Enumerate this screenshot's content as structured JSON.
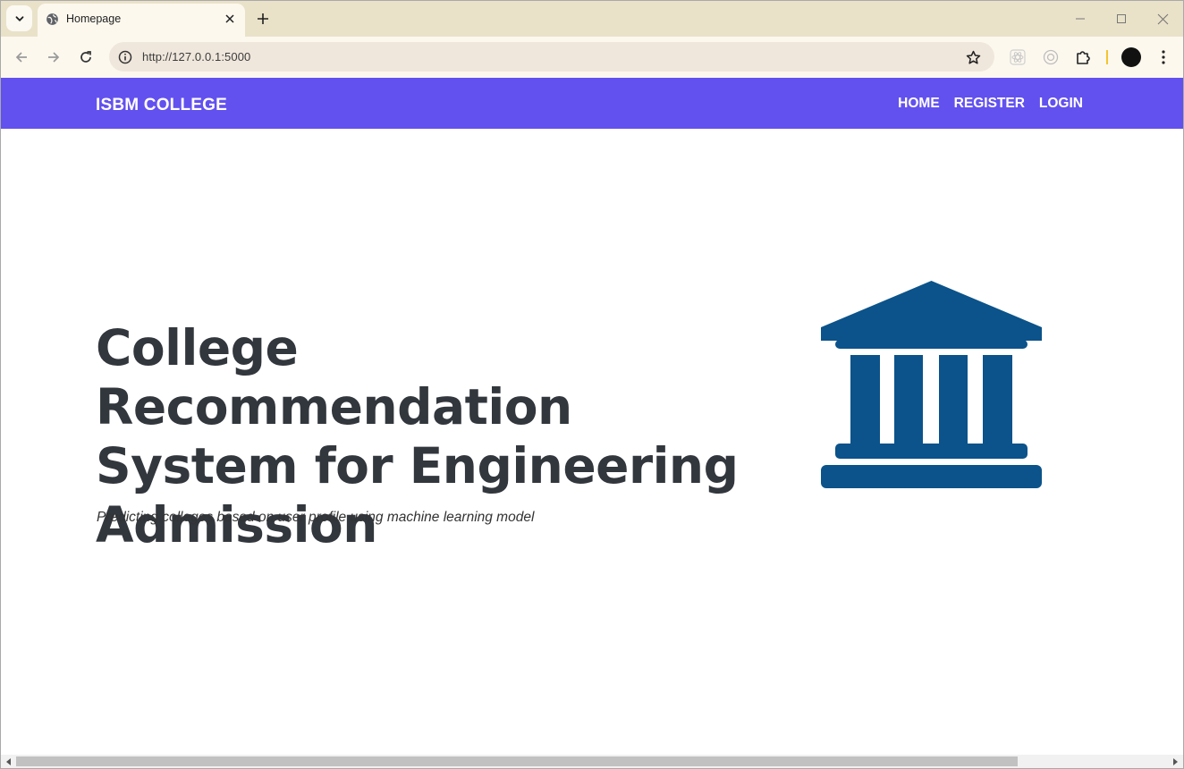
{
  "browser": {
    "tab_title": "Homepage",
    "url": "http://127.0.0.1:5000",
    "colors": {
      "tabstrip": "#e9e2c9",
      "toolbar": "#fcf8ee",
      "omnibox": "#efe7dc"
    }
  },
  "site": {
    "brand": "ISBM COLLEGE",
    "nav": [
      {
        "label": "HOME"
      },
      {
        "label": "REGISTER"
      },
      {
        "label": "LOGIN"
      }
    ],
    "hero": {
      "title_lines": [
        "College Recommendation",
        "System for Engineering",
        "Admission"
      ],
      "subtitle": "Predicting colleges based on user profile using machine learning model",
      "icon": "university-building-icon"
    },
    "colors": {
      "navbar": "#6251ef",
      "icon": "#0b538a",
      "title": "#32373d"
    }
  }
}
